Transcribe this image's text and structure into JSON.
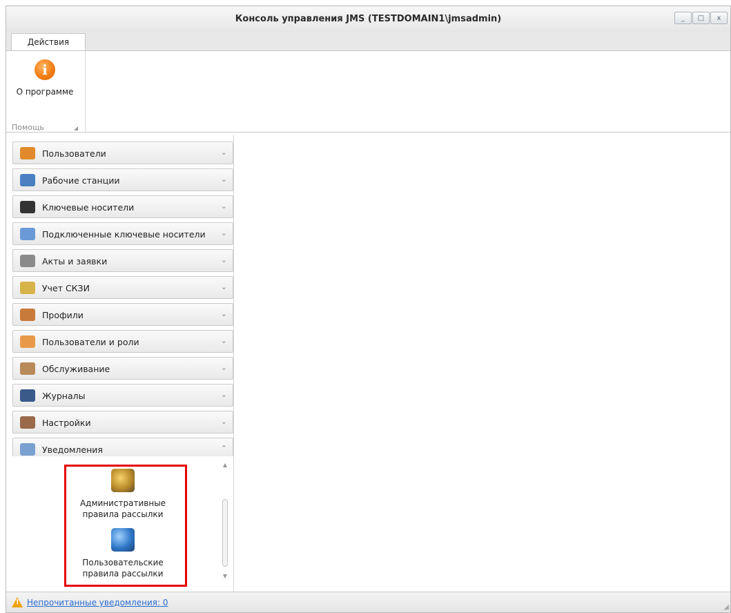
{
  "window": {
    "title": "Консоль управления JMS (TESTDOMAIN1\\jmsadmin)",
    "controls": {
      "minimize": "_",
      "maximize": "□",
      "close": "x"
    }
  },
  "ribbon": {
    "tab": "Действия",
    "group_caption": "Помощь",
    "about_label": "О программе",
    "about_icon_glyph": "i"
  },
  "nav": {
    "items": [
      {
        "label": "Пользователи",
        "icon": "users-icon",
        "expanded": false
      },
      {
        "label": "Рабочие станции",
        "icon": "workstations-icon",
        "expanded": false
      },
      {
        "label": "Ключевые носители",
        "icon": "usb-key-icon",
        "expanded": false
      },
      {
        "label": "Подключенные ключевые носители",
        "icon": "connected-keys-icon",
        "expanded": false
      },
      {
        "label": "Акты и заявки",
        "icon": "printer-icon",
        "expanded": false
      },
      {
        "label": "Учет СКЗИ",
        "icon": "lock-icon",
        "expanded": false
      },
      {
        "label": "Профили",
        "icon": "profiles-icon",
        "expanded": false
      },
      {
        "label": "Пользователи и роли",
        "icon": "shield-icon",
        "expanded": false
      },
      {
        "label": "Обслуживание",
        "icon": "clipboard-icon",
        "expanded": false
      },
      {
        "label": "Журналы",
        "icon": "log-icon",
        "expanded": false
      },
      {
        "label": "Настройки",
        "icon": "settings-icon",
        "expanded": false
      },
      {
        "label": "Уведомления",
        "icon": "envelope-info-icon",
        "expanded": true
      }
    ],
    "chevron_collapsed": "⌄",
    "chevron_expanded": "⌃",
    "notifications": [
      {
        "label": "Административные правила рассылки",
        "icon": "admin-mailing-rules-icon"
      },
      {
        "label": "Пользовательские правила рассылки",
        "icon": "user-mailing-rules-icon"
      }
    ]
  },
  "status": {
    "unread_link": "Непрочитанные уведомления: 0"
  },
  "colors": {
    "accent_orange": "#f07b12",
    "highlight_red": "#e50000",
    "link_blue": "#2a6cd0"
  }
}
